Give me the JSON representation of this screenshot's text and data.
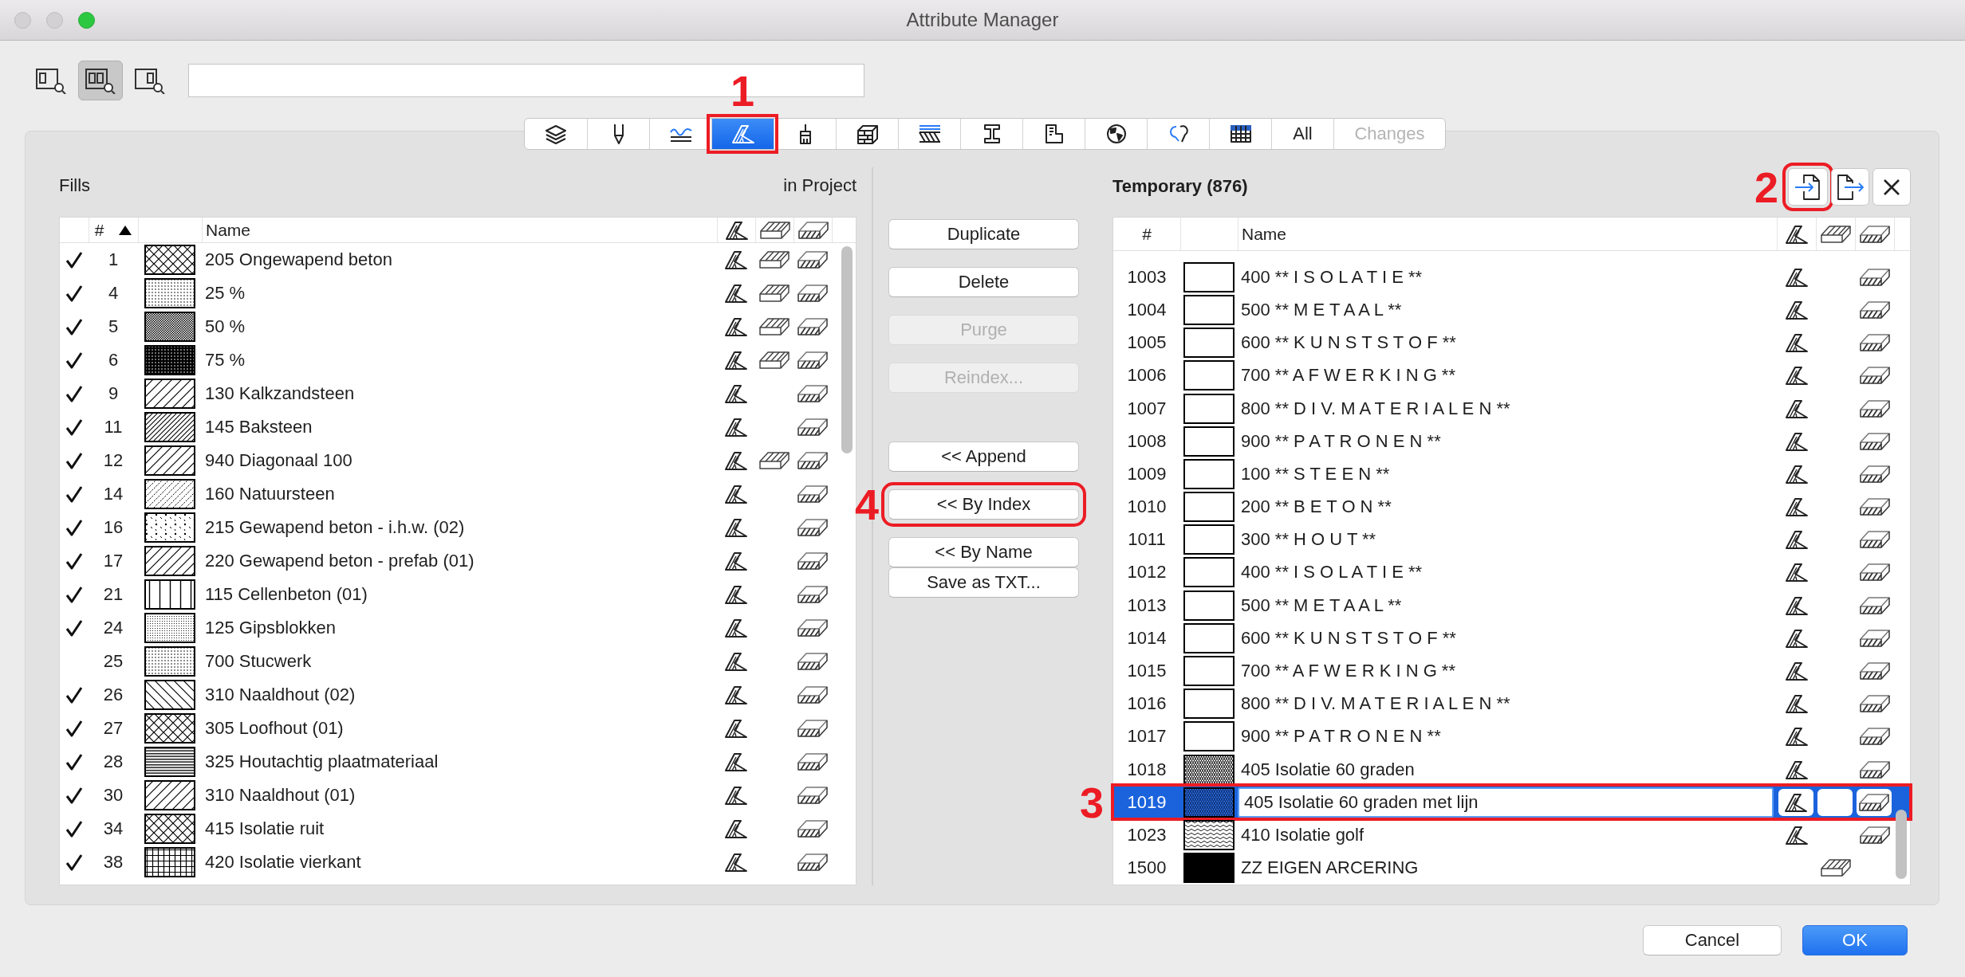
{
  "window": {
    "title": "Attribute Manager"
  },
  "view_modes": [
    {
      "kind": "single",
      "selected": false
    },
    {
      "kind": "dual",
      "selected": true
    },
    {
      "kind": "right",
      "selected": false
    }
  ],
  "tabs": [
    {
      "kind": "layers",
      "selected": false,
      "disabled": false
    },
    {
      "kind": "pen",
      "selected": false,
      "disabled": false
    },
    {
      "kind": "line-type",
      "selected": false,
      "disabled": false
    },
    {
      "kind": "hatch",
      "selected": true,
      "disabled": false,
      "marker": "1"
    },
    {
      "kind": "brush",
      "selected": false,
      "disabled": false
    },
    {
      "kind": "brick",
      "selected": false,
      "disabled": false
    },
    {
      "kind": "stripes",
      "selected": false,
      "disabled": false
    },
    {
      "kind": "i-beam",
      "selected": false,
      "disabled": false
    },
    {
      "kind": "floor-plan",
      "selected": false,
      "disabled": false
    },
    {
      "kind": "globe",
      "selected": false,
      "disabled": false
    },
    {
      "kind": "swirl",
      "selected": false,
      "disabled": false
    },
    {
      "kind": "table",
      "selected": false,
      "disabled": false
    },
    {
      "label": "All",
      "selected": false,
      "disabled": false
    },
    {
      "label": "Changes",
      "selected": false,
      "disabled": true
    }
  ],
  "left_pane": {
    "title": "Fills",
    "subtitle": "in Project",
    "columns": {
      "index": "#",
      "name": "Name"
    },
    "rows": [
      {
        "in_project": true,
        "index": "1",
        "kind": "crosshatch",
        "name": "205 Ongewapend beton",
        "drafting": true,
        "cover": true,
        "cut": true,
        "selected": false
      },
      {
        "in_project": true,
        "index": "4",
        "kind": "dots-25",
        "name": "25 %",
        "drafting": true,
        "cover": true,
        "cut": true,
        "selected": false
      },
      {
        "in_project": true,
        "index": "5",
        "kind": "dots-50",
        "name": "50 %",
        "drafting": true,
        "cover": true,
        "cut": true,
        "selected": false
      },
      {
        "in_project": true,
        "index": "6",
        "kind": "dots-75",
        "name": "75 %",
        "drafting": true,
        "cover": true,
        "cut": true,
        "selected": false
      },
      {
        "in_project": true,
        "index": "9",
        "kind": "diagonal",
        "name": "130 Kalkzandsteen",
        "drafting": true,
        "cover": false,
        "cut": true,
        "selected": false
      },
      {
        "in_project": true,
        "index": "11",
        "kind": "diagonal-dense",
        "name": "145 Baksteen",
        "drafting": true,
        "cover": false,
        "cut": true,
        "selected": false
      },
      {
        "in_project": true,
        "index": "12",
        "kind": "diagonal",
        "name": "940 Diagonaal 100",
        "drafting": true,
        "cover": true,
        "cut": true,
        "selected": false
      },
      {
        "in_project": true,
        "index": "14",
        "kind": "diagonal-dotted",
        "name": "160 Natuursteen",
        "drafting": true,
        "cover": false,
        "cut": true,
        "selected": false
      },
      {
        "in_project": true,
        "index": "16",
        "kind": "rebar",
        "name": "215 Gewapend beton - i.h.w. (02)",
        "drafting": true,
        "cover": false,
        "cut": true,
        "selected": false
      },
      {
        "in_project": true,
        "index": "17",
        "kind": "diagonal",
        "name": "220 Gewapend beton - prefab (01)",
        "drafting": true,
        "cover": false,
        "cut": true,
        "selected": false
      },
      {
        "in_project": true,
        "index": "21",
        "kind": "vertical",
        "name": "115 Cellenbeton (01)",
        "drafting": true,
        "cover": false,
        "cut": true,
        "selected": false
      },
      {
        "in_project": true,
        "index": "24",
        "kind": "dots-fine",
        "name": "125 Gipsblokken",
        "drafting": true,
        "cover": false,
        "cut": true,
        "selected": false
      },
      {
        "in_project": false,
        "index": "25",
        "kind": "dots-25",
        "name": "700 Stucwerk",
        "drafting": true,
        "cover": false,
        "cut": true,
        "selected": false
      },
      {
        "in_project": true,
        "index": "26",
        "kind": "back-diagonal",
        "name": "310 Naaldhout (02)",
        "drafting": true,
        "cover": false,
        "cut": true,
        "selected": false
      },
      {
        "in_project": true,
        "index": "27",
        "kind": "crosshatch",
        "name": "305 Loofhout (01)",
        "drafting": true,
        "cover": false,
        "cut": true,
        "selected": false
      },
      {
        "in_project": true,
        "index": "28",
        "kind": "horizontal",
        "name": "325 Houtachtig plaatmateriaal",
        "drafting": true,
        "cover": false,
        "cut": true,
        "selected": false
      },
      {
        "in_project": true,
        "index": "30",
        "kind": "diagonal",
        "name": "310 Naaldhout (01)",
        "drafting": true,
        "cover": false,
        "cut": true,
        "selected": false
      },
      {
        "in_project": true,
        "index": "34",
        "kind": "crosshatch",
        "name": "415 Isolatie ruit",
        "drafting": true,
        "cover": false,
        "cut": true,
        "selected": false
      },
      {
        "in_project": true,
        "index": "38",
        "kind": "grid",
        "name": "420 Isolatie vierkant",
        "drafting": true,
        "cover": false,
        "cut": true,
        "selected": false
      }
    ]
  },
  "edit_buttons": [
    {
      "label": "Duplicate",
      "disabled": false
    },
    {
      "label": "Delete",
      "disabled": false
    },
    {
      "label": "Purge",
      "disabled": true
    },
    {
      "label": "Reindex...",
      "disabled": true
    }
  ],
  "merge_buttons": [
    {
      "label": "<< Append",
      "disabled": false
    },
    {
      "label": "<< By Index",
      "disabled": false,
      "marker": "4"
    },
    {
      "label": "<< By Name",
      "disabled": false
    }
  ],
  "save_button": {
    "label": "Save as TXT..."
  },
  "right_pane": {
    "title": "Temporary (876)",
    "actions": [
      {
        "kind": "import",
        "marker": "2"
      },
      {
        "kind": "export"
      },
      {
        "kind": "close"
      }
    ],
    "columns": {
      "index": "#",
      "name": "Name"
    },
    "rows": [
      {
        "index": "1003",
        "kind": "empty",
        "name": "400 ** I S O L A T I E **",
        "drafting": true,
        "cover": false,
        "cut": true,
        "selected": false
      },
      {
        "index": "1004",
        "kind": "empty",
        "name": "500 ** M E T A A L **",
        "drafting": true,
        "cover": false,
        "cut": true,
        "selected": false
      },
      {
        "index": "1005",
        "kind": "empty",
        "name": "600 ** K U N S T S T O F **",
        "drafting": true,
        "cover": false,
        "cut": true,
        "selected": false
      },
      {
        "index": "1006",
        "kind": "empty",
        "name": "700 ** A F W E R K I N G **",
        "drafting": true,
        "cover": false,
        "cut": true,
        "selected": false
      },
      {
        "index": "1007",
        "kind": "empty",
        "name": "800 ** D I V. M A T E R I A L E N **",
        "drafting": true,
        "cover": false,
        "cut": true,
        "selected": false
      },
      {
        "index": "1008",
        "kind": "empty",
        "name": "900 ** P A T R O N E N **",
        "drafting": true,
        "cover": false,
        "cut": true,
        "selected": false
      },
      {
        "index": "1009",
        "kind": "empty",
        "name": "100 ** S T E E N **",
        "drafting": true,
        "cover": false,
        "cut": true,
        "selected": false
      },
      {
        "index": "1010",
        "kind": "empty",
        "name": "200 ** B E T O N **",
        "drafting": true,
        "cover": false,
        "cut": true,
        "selected": false
      },
      {
        "index": "1011",
        "kind": "empty",
        "name": "300 ** H O U T **",
        "drafting": true,
        "cover": false,
        "cut": true,
        "selected": false
      },
      {
        "index": "1012",
        "kind": "empty",
        "name": "400 ** I S O L A T I E **",
        "drafting": true,
        "cover": false,
        "cut": true,
        "selected": false
      },
      {
        "index": "1013",
        "kind": "empty",
        "name": "500 ** M E T A A L **",
        "drafting": true,
        "cover": false,
        "cut": true,
        "selected": false
      },
      {
        "index": "1014",
        "kind": "empty",
        "name": "600 ** K U N S T S T O F **",
        "drafting": true,
        "cover": false,
        "cut": true,
        "selected": false
      },
      {
        "index": "1015",
        "kind": "empty",
        "name": "700 ** A F W E R K I N G **",
        "drafting": true,
        "cover": false,
        "cut": true,
        "selected": false
      },
      {
        "index": "1016",
        "kind": "empty",
        "name": "800 ** D I V. M A T E R I A L E N **",
        "drafting": true,
        "cover": false,
        "cut": true,
        "selected": false
      },
      {
        "index": "1017",
        "kind": "empty",
        "name": "900 ** P A T R O N E N **",
        "drafting": true,
        "cover": false,
        "cut": true,
        "selected": false
      },
      {
        "index": "1018",
        "kind": "zigzag",
        "name": "405 Isolatie 60 graden",
        "drafting": true,
        "cover": false,
        "cut": true,
        "selected": false
      },
      {
        "index": "1019",
        "kind": "zigzag",
        "name": "405 Isolatie 60 graden met lijn",
        "drafting": true,
        "cover": false,
        "cut": true,
        "selected": true,
        "marker": "3"
      },
      {
        "index": "1023",
        "kind": "wave",
        "name": "410 Isolatie golf",
        "drafting": true,
        "cover": false,
        "cut": true,
        "selected": false
      },
      {
        "index": "1500",
        "kind": "solid",
        "name": "ZZ EIGEN ARCERING",
        "drafting": false,
        "cover": true,
        "cut": false,
        "selected": false
      }
    ]
  },
  "dialog_buttons": [
    {
      "label": "Cancel",
      "default": false
    },
    {
      "label": "OK",
      "default": true
    }
  ]
}
